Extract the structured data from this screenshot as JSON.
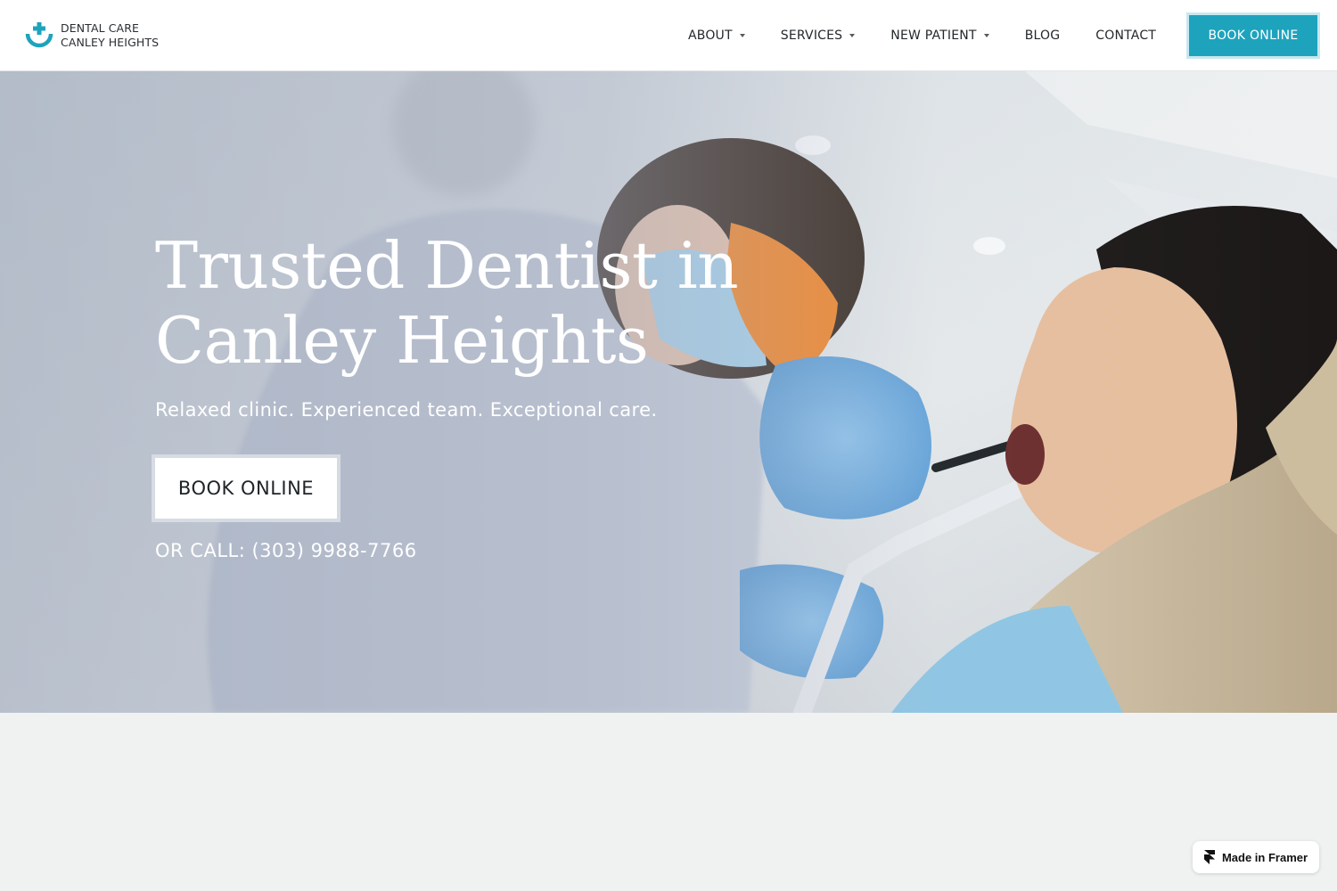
{
  "brand": {
    "line1": "DENTAL CARE",
    "line2": "CANLEY HEIGHTS",
    "accent_color": "#1ea3bd",
    "logo_icon": "tooth-cross-icon"
  },
  "nav": {
    "items": [
      {
        "label": "ABOUT",
        "has_dropdown": true
      },
      {
        "label": "SERVICES",
        "has_dropdown": true
      },
      {
        "label": "NEW PATIENT",
        "has_dropdown": true
      },
      {
        "label": "BLOG",
        "has_dropdown": false
      },
      {
        "label": "CONTACT",
        "has_dropdown": false
      }
    ],
    "cta_label": "BOOK ONLINE"
  },
  "hero": {
    "title_line1": "Trusted Dentist in",
    "title_line2": "Canley Heights",
    "subtitle": "Relaxed clinic. Experienced team. Exceptional care.",
    "button_label": "BOOK ONLINE",
    "call_text": "OR CALL: (303) 9988-7766"
  },
  "badge": {
    "label": "Made in Framer",
    "icon": "framer-icon"
  }
}
